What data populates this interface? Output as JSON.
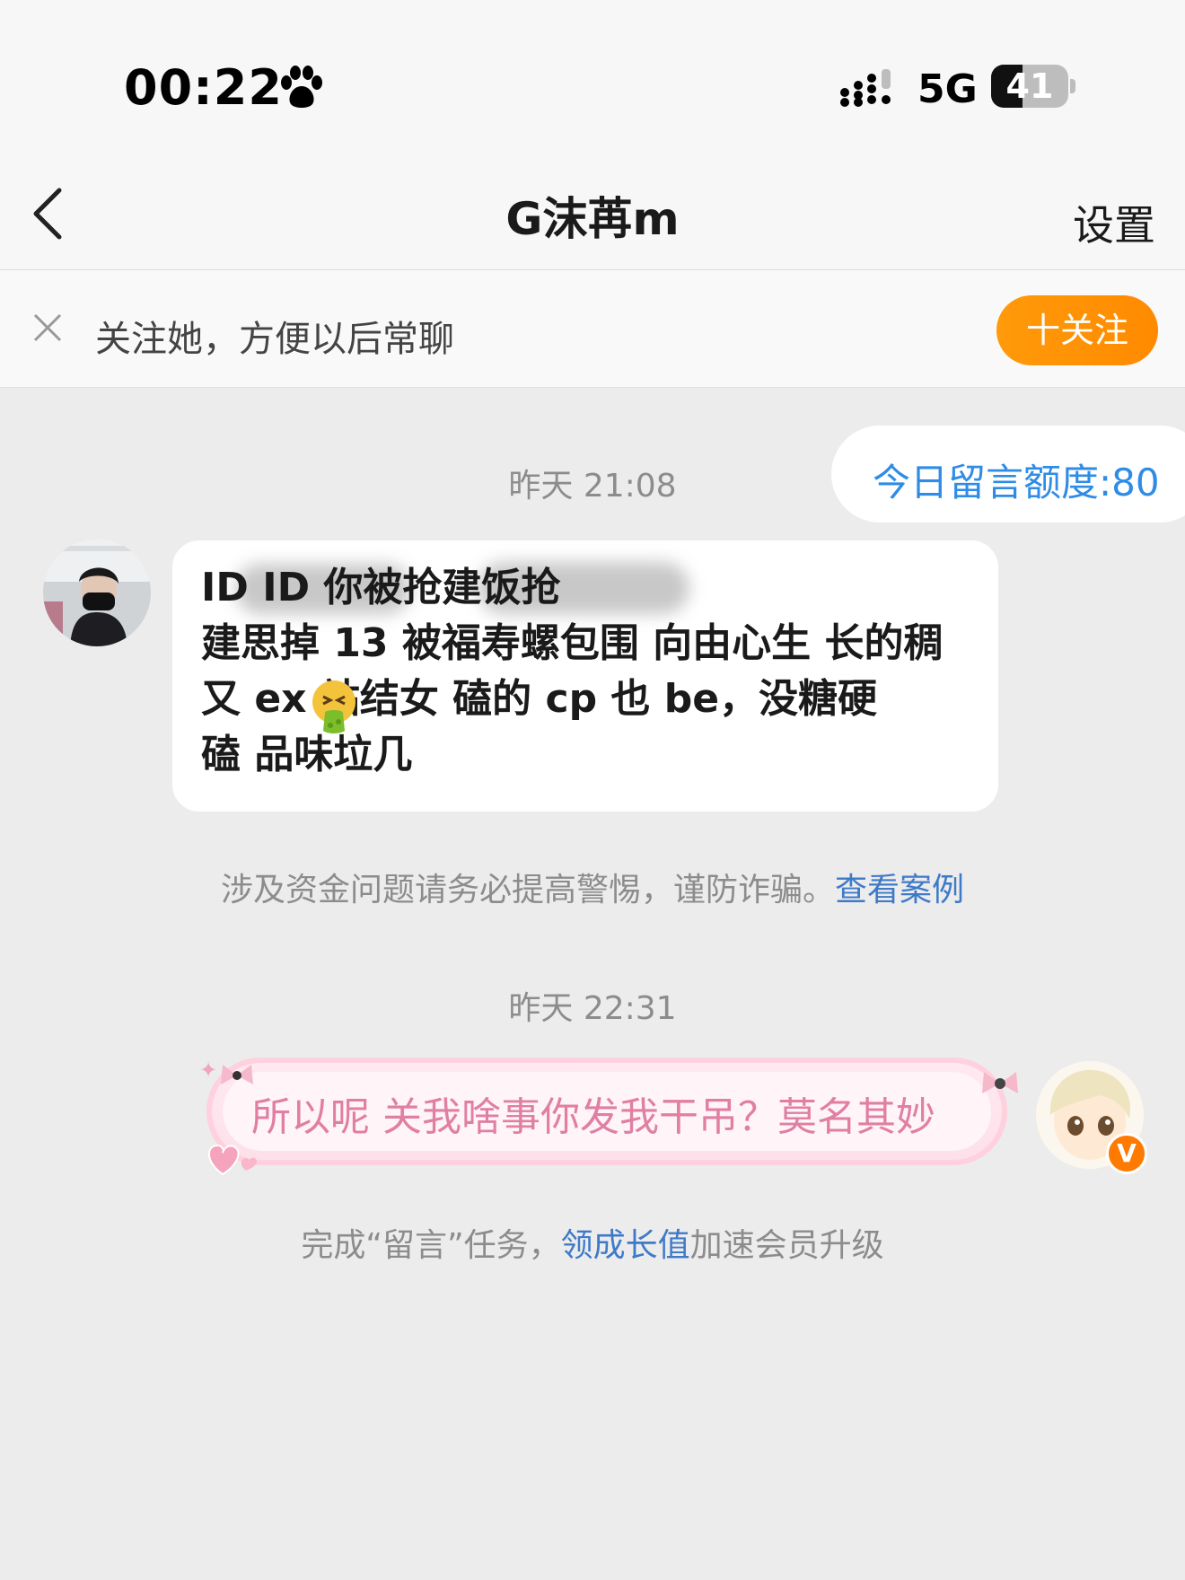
{
  "status_bar": {
    "time": "00:22",
    "network": "5G",
    "battery_level": "41",
    "battery_fraction": 0.41,
    "icons": [
      "paw-icon",
      "signal-icon",
      "battery-icon"
    ]
  },
  "nav": {
    "title": "G沫苒m",
    "settings_label": "设置",
    "back_icon": "chevron-left-icon"
  },
  "follow_banner": {
    "text": "关注她，方便以后常聊",
    "button_label": "十关注",
    "close_icon": "close-icon"
  },
  "quota": {
    "label": "今日留言额度:80"
  },
  "messages": [
    {
      "timestamp": "昨天 21:08",
      "direction": "incoming",
      "lines": [
        "ID           ID                你被抢建饭抢",
        "建思掉 13 被福寿螺包围 向由心生 长的稠",
        "又 ex     站结女 磕的 cp 也 be，没糖硬",
        "磕 品味垃几"
      ],
      "emoji": "nauseated-face-icon"
    },
    {
      "timestamp": "昨天 22:31",
      "direction": "outgoing",
      "text": "所以呢 关我啥事你发我干吊？莫名其妙"
    }
  ],
  "warning": {
    "text": "涉及资金问题请务必提高警惕，谨防诈骗。",
    "link": "查看案例"
  },
  "task_tip": {
    "prefix": "完成“留言”任务，",
    "link": "领成长值",
    "suffix": "加速会员升级"
  },
  "vip_badge": "V",
  "colors": {
    "accent_orange": "#ff8c00",
    "link_blue": "#3f7ac8",
    "quota_blue": "#2f8ce6",
    "pink_text": "#e07fa2",
    "background": "#ececec"
  }
}
